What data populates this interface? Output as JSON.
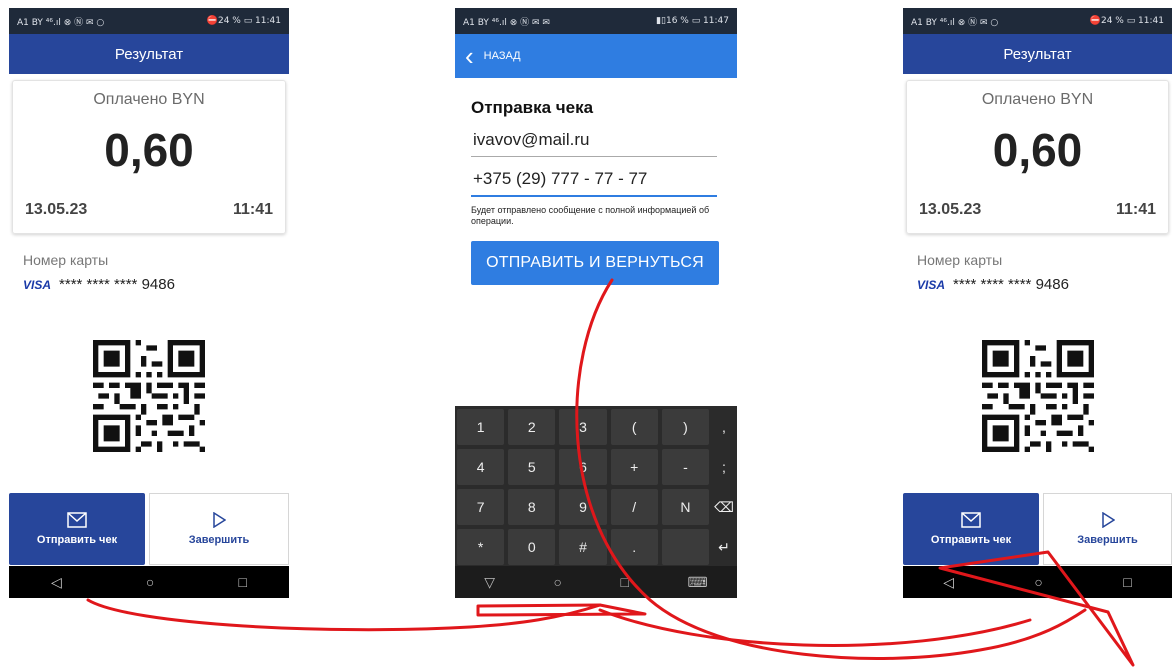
{
  "left": {
    "status_left": "A1 BY ⁴⁶.ıl ⊗ Ⓝ ✉ ○",
    "status_right": "⛔24 % ▭ 11:41",
    "title": "Результат",
    "paid_label": "Оплачено BYN",
    "amount": "0,60",
    "date": "13.05.23",
    "time": "11:41",
    "card_label": "Номер карты",
    "card_brand": "VISA",
    "card_number": "**** **** **** 9486",
    "send_label": "Отправить чек",
    "finish_label": "Завершить"
  },
  "middle": {
    "status_left": "A1 BY ⁴⁶.ıl ⊗ Ⓝ ✉ ✉",
    "status_right": "▮▯16 % ▭ 11:47",
    "back_label": "НАЗАД",
    "title": "Отправка чека",
    "email_value": "ivavov@mail.ru",
    "phone_value": "+375 (29) 777 - 77 - 77",
    "hint": "Будет отправлено сообщение с полной информацией об операции.",
    "send_button": "ОТПРАВИТЬ И ВЕРНУТЬСЯ",
    "keys": [
      "1",
      "2",
      "3",
      "(",
      ")",
      ",",
      "4",
      "5",
      "6",
      "+",
      "-",
      ";",
      "7",
      "8",
      "9",
      "/",
      "N",
      "⌫",
      "*",
      "0",
      "#",
      ".",
      "",
      "↵"
    ]
  },
  "right": {
    "status_left": "A1 BY ⁴⁶.ıl ⊗ Ⓝ ✉ ○",
    "status_right": "⛔24 % ▭ 11:41",
    "title": "Результат",
    "paid_label": "Оплачено BYN",
    "amount": "0,60",
    "date": "13.05.23",
    "time": "11:41",
    "card_label": "Номер карты",
    "card_brand": "VISA",
    "card_number": "**** **** **** 9486",
    "send_label": "Отправить чек",
    "finish_label": "Завершить"
  },
  "icons": {
    "send": "envelope-icon",
    "finish": "play-icon",
    "nav_back": "back-triangle-icon",
    "nav_home": "home-circle-icon",
    "nav_recent": "recent-square-icon",
    "back": "chevron-left-icon"
  },
  "colors": {
    "header_blue": "#27469b",
    "accent_blue": "#2f7de1",
    "arrow_red": "#e0171b"
  }
}
